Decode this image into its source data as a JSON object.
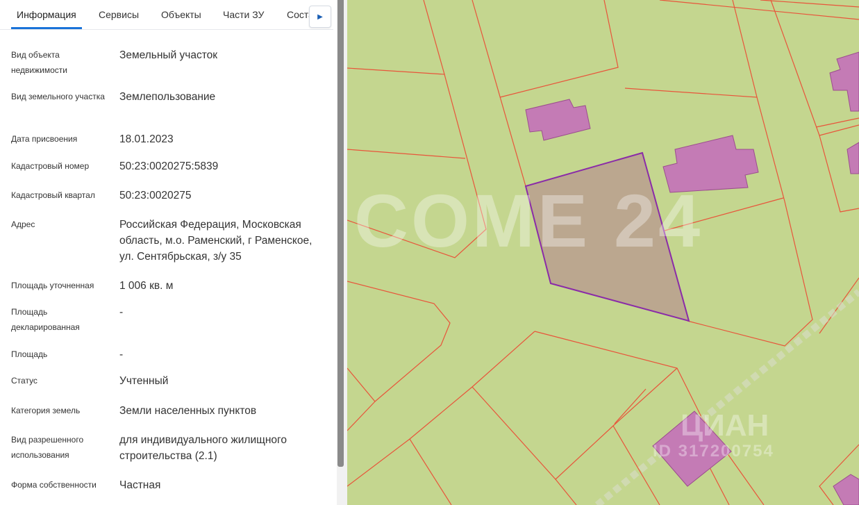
{
  "tabs": [
    {
      "label": "Информация",
      "active": true
    },
    {
      "label": "Сервисы"
    },
    {
      "label": "Объекты"
    },
    {
      "label": "Части ЗУ"
    },
    {
      "label": "Состав"
    }
  ],
  "tab_next_icon": "triangle-right-icon",
  "fields": [
    {
      "label": "Вид объекта недвижимости",
      "value": "Земельный участок"
    },
    {
      "label": "Вид земельного участка",
      "value": "Землепользование"
    },
    {
      "label": "Дата присвоения",
      "value": "18.01.2023"
    },
    {
      "label": "Кадастровый номер",
      "value": "50:23:0020275:5839"
    },
    {
      "label": "Кадастровый квартал",
      "value": "50:23:0020275"
    },
    {
      "label": "Адрес",
      "value": "Российская Федерация, Московская область, м.о. Раменский, г Раменское, ул. Сентябрьская, з/у 35"
    },
    {
      "label": "Площадь уточненная",
      "value": "1 006 кв. м"
    },
    {
      "label": "Площадь декларированная",
      "value": "-"
    },
    {
      "label": "Площадь",
      "value": "-"
    },
    {
      "label": "Статус",
      "value": "Учтенный"
    },
    {
      "label": "Категория земель",
      "value": "Земли населенных пунктов"
    },
    {
      "label": "Вид разрешенного использования",
      "value": "для индивидуального жилищного строительства (2.1)"
    },
    {
      "label": "Форма собственности",
      "value": "Частная"
    }
  ],
  "map": {
    "watermark_1": "COME 24",
    "watermark_2": "ЦИАН",
    "watermark_3": "ID 317200754",
    "colors": {
      "land": "#c4d68f",
      "boundary": "#e8543a",
      "building": "#c47bb5",
      "selected_fill": "#bba78f",
      "selected_stroke": "#8a2ba8"
    }
  }
}
